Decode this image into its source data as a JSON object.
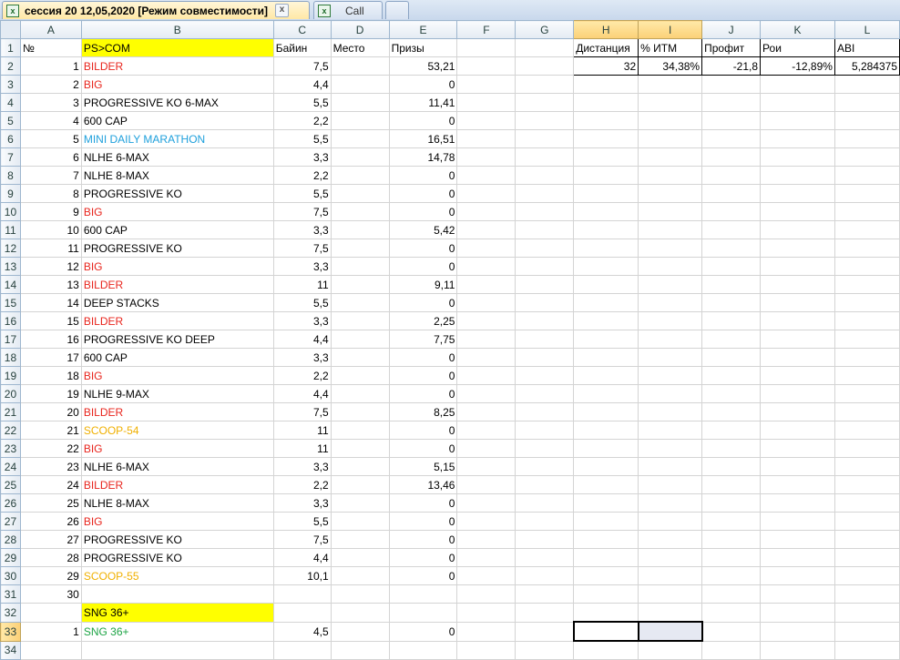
{
  "tabs": [
    {
      "title": "сессия 20 12,05,2020  [Режим совместимости]",
      "close": "x",
      "icon": "x"
    },
    {
      "title": "Call",
      "icon": "x"
    }
  ],
  "columns": [
    "A",
    "B",
    "C",
    "D",
    "E",
    "F",
    "G",
    "H",
    "I",
    "J",
    "K",
    "L"
  ],
  "header_row": {
    "a": "№",
    "b": "PS>COM",
    "c": "Байин",
    "d": "Место",
    "e": "Призы"
  },
  "stats": {
    "labels": [
      "Дистанция",
      "% ИТМ",
      "Профит",
      "Рои",
      "ABI"
    ],
    "values": [
      "32",
      "34,38%",
      "-21,8",
      "-12,89%",
      "5,284375"
    ]
  },
  "rows": [
    {
      "n": "2",
      "a": "1",
      "b": "BILDER",
      "bc": "red",
      "c": "7,5",
      "d": "",
      "e": "53,21"
    },
    {
      "n": "3",
      "a": "2",
      "b": "BIG",
      "bc": "red",
      "c": "4,4",
      "d": "",
      "e": "0"
    },
    {
      "n": "4",
      "a": "3",
      "b": "PROGRESSIVE KO 6-MAX",
      "bc": "",
      "c": "5,5",
      "d": "",
      "e": "11,41"
    },
    {
      "n": "5",
      "a": "4",
      "b": "600 CAP",
      "bc": "",
      "c": "2,2",
      "d": "",
      "e": "0"
    },
    {
      "n": "6",
      "a": "5",
      "b": "MINI DAILY MARATHON",
      "bc": "blue",
      "c": "5,5",
      "d": "",
      "e": "16,51"
    },
    {
      "n": "7",
      "a": "6",
      "b": "NLHE 6-MAX",
      "bc": "",
      "c": "3,3",
      "d": "",
      "e": "14,78"
    },
    {
      "n": "8",
      "a": "7",
      "b": "NLHE 8-MAX",
      "bc": "",
      "c": "2,2",
      "d": "",
      "e": "0"
    },
    {
      "n": "9",
      "a": "8",
      "b": "PROGRESSIVE KO",
      "bc": "",
      "c": "5,5",
      "d": "",
      "e": "0"
    },
    {
      "n": "10",
      "a": "9",
      "b": "BIG",
      "bc": "red",
      "c": "7,5",
      "d": "",
      "e": "0"
    },
    {
      "n": "11",
      "a": "10",
      "b": "600 CAP",
      "bc": "",
      "c": "3,3",
      "d": "",
      "e": "5,42"
    },
    {
      "n": "12",
      "a": "11",
      "b": "PROGRESSIVE KO",
      "bc": "",
      "c": "7,5",
      "d": "",
      "e": "0"
    },
    {
      "n": "13",
      "a": "12",
      "b": "BIG",
      "bc": "red",
      "c": "3,3",
      "d": "",
      "e": "0"
    },
    {
      "n": "14",
      "a": "13",
      "b": "BILDER",
      "bc": "red",
      "c": "11",
      "d": "",
      "e": "9,11"
    },
    {
      "n": "15",
      "a": "14",
      "b": "DEEP STACKS",
      "bc": "",
      "c": "5,5",
      "d": "",
      "e": "0"
    },
    {
      "n": "16",
      "a": "15",
      "b": "BILDER",
      "bc": "red",
      "c": "3,3",
      "d": "",
      "e": "2,25"
    },
    {
      "n": "17",
      "a": "16",
      "b": "PROGRESSIVE KO DEEP",
      "bc": "",
      "c": "4,4",
      "d": "",
      "e": "7,75"
    },
    {
      "n": "18",
      "a": "17",
      "b": "600 CAP",
      "bc": "",
      "c": "3,3",
      "d": "",
      "e": "0"
    },
    {
      "n": "19",
      "a": "18",
      "b": "BIG",
      "bc": "red",
      "c": "2,2",
      "d": "",
      "e": "0"
    },
    {
      "n": "20",
      "a": "19",
      "b": "NLHE 9-MAX",
      "bc": "",
      "c": "4,4",
      "d": "",
      "e": "0"
    },
    {
      "n": "21",
      "a": "20",
      "b": "BILDER",
      "bc": "red",
      "c": "7,5",
      "d": "",
      "e": "8,25"
    },
    {
      "n": "22",
      "a": "21",
      "b": "SCOOP-54",
      "bc": "orange",
      "c": "11",
      "d": "",
      "e": "0"
    },
    {
      "n": "23",
      "a": "22",
      "b": "BIG",
      "bc": "red",
      "c": "11",
      "d": "",
      "e": "0"
    },
    {
      "n": "24",
      "a": "23",
      "b": "NLHE 6-MAX",
      "bc": "",
      "c": "3,3",
      "d": "",
      "e": "5,15"
    },
    {
      "n": "25",
      "a": "24",
      "b": "BILDER",
      "bc": "red",
      "c": "2,2",
      "d": "",
      "e": "13,46"
    },
    {
      "n": "26",
      "a": "25",
      "b": "NLHE 8-MAX",
      "bc": "",
      "c": "3,3",
      "d": "",
      "e": "0"
    },
    {
      "n": "27",
      "a": "26",
      "b": "BIG",
      "bc": "red",
      "c": "5,5",
      "d": "",
      "e": "0"
    },
    {
      "n": "28",
      "a": "27",
      "b": "PROGRESSIVE KO",
      "bc": "",
      "c": "7,5",
      "d": "",
      "e": "0"
    },
    {
      "n": "29",
      "a": "28",
      "b": "PROGRESSIVE KO",
      "bc": "",
      "c": "4,4",
      "d": "",
      "e": "0"
    },
    {
      "n": "30",
      "a": "29",
      "b": "SCOOP-55",
      "bc": "orange",
      "c": "10,1",
      "d": "",
      "e": "0"
    },
    {
      "n": "31",
      "a": "30",
      "b": "",
      "bc": "",
      "c": "",
      "d": "",
      "e": ""
    },
    {
      "n": "32",
      "a": "",
      "b": "SNG 36+",
      "bc": "yellow",
      "c": "",
      "d": "",
      "e": ""
    },
    {
      "n": "33",
      "a": "1",
      "b": "SNG 36+",
      "bc": "green",
      "c": "4,5",
      "d": "",
      "e": "0"
    },
    {
      "n": "34",
      "a": "",
      "b": "",
      "bc": "",
      "c": "",
      "d": "",
      "e": ""
    }
  ],
  "colors": {
    "highlight": "#ffff00",
    "red_text": "#e8251d",
    "blue_text": "#1fa0dc",
    "orange_text": "#f0b000",
    "green_text": "#1ea446"
  }
}
